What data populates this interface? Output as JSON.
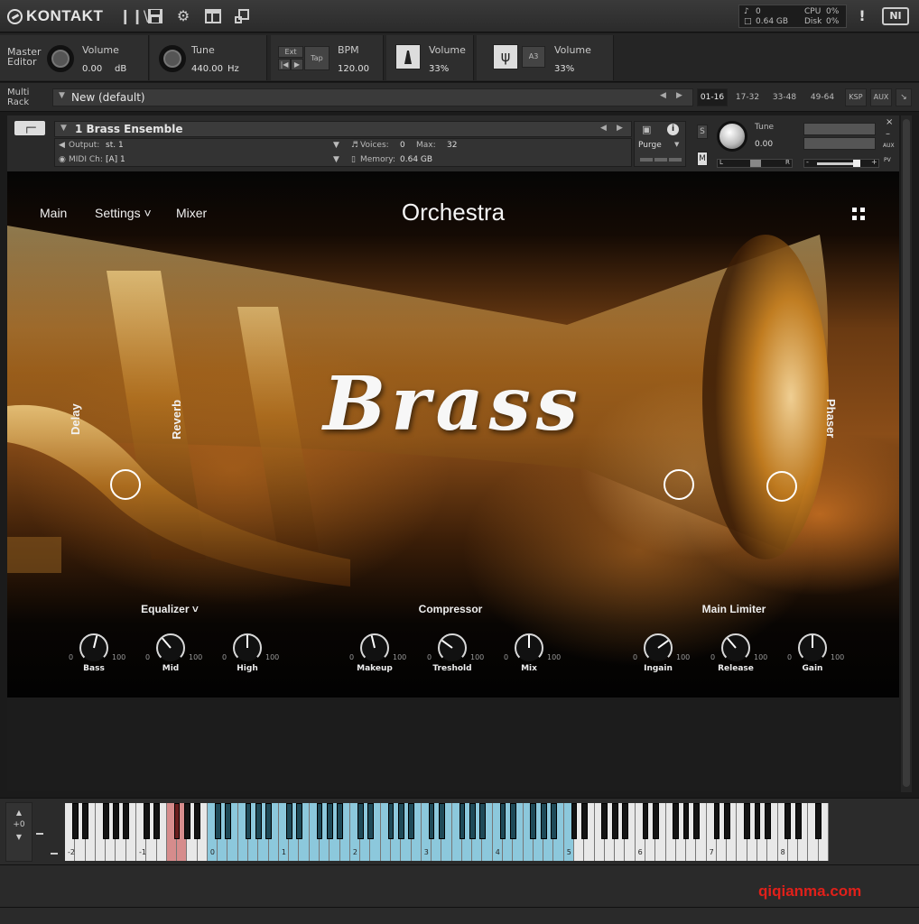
{
  "app": {
    "logo_text": "KONTAKT",
    "status": {
      "midi_label": "♪",
      "midi_value": "0",
      "mem_label": "□",
      "mem_value": "0.64 GB",
      "cpu_label": "CPU",
      "cpu_value": "0%",
      "disk_label": "Disk",
      "disk_value": "0%"
    },
    "warning": "!",
    "ni_badge": "NI"
  },
  "master": {
    "editor_line1": "Master",
    "editor_line2": "Editor",
    "volume_label": "Volume",
    "volume_value": "0.00",
    "volume_unit": "dB",
    "tune_label": "Tune",
    "tune_value": "440.00",
    "tune_unit": "Hz",
    "ext_label": "Ext",
    "tap_label": "Tap",
    "bpm_label": "BPM",
    "bpm_value": "120.00",
    "metro_volume_label": "Volume",
    "metro_volume_value": "33%",
    "ref_volume_label": "Volume",
    "ref_note": "A3",
    "ref_volume_value": "33%"
  },
  "rack": {
    "line1": "Multi",
    "line2": "Rack",
    "name": "New (default)",
    "tabs": [
      "01-16",
      "17-32",
      "33-48",
      "49-64",
      "KSP",
      "AUX"
    ]
  },
  "instrument": {
    "name": "1 Brass Ensemble",
    "output_label": "Output:",
    "output_value": "st. 1",
    "voices_label": "Voices:",
    "voices_value": "0",
    "max_label": "Max:",
    "max_value": "32",
    "midi_label": "MIDI Ch:",
    "midi_value": "[A]  1",
    "memory_label": "Memory:",
    "memory_value": "0.64 GB",
    "purge_label": "Purge",
    "solo": "S",
    "mute": "M",
    "tune_label": "Tune",
    "tune_value": "0.00",
    "pan_left": "L",
    "pan_right": "R",
    "aux": "AUX",
    "pv": "PV",
    "minus": "-",
    "plus": "+"
  },
  "ui": {
    "nav": {
      "main": "Main",
      "settings": "Settings ˅",
      "mixer": "Mixer"
    },
    "title": "Orchestra",
    "logo": "Brass",
    "fx": {
      "delay": "Delay",
      "reverb": "Reverb",
      "phaser": "Phaser"
    },
    "sections": {
      "eq": "Equalizer ˅",
      "comp": "Compressor",
      "limiter": "Main Limiter"
    },
    "knobs": [
      {
        "label": "Bass",
        "min": "0",
        "max": "100",
        "value": 55
      },
      {
        "label": "Mid",
        "min": "0",
        "max": "100",
        "value": 35
      },
      {
        "label": "High",
        "min": "0",
        "max": "100",
        "value": 50
      },
      {
        "label": "Makeup",
        "min": "0",
        "max": "100",
        "value": 45
      },
      {
        "label": "Treshold",
        "min": "0",
        "max": "100",
        "value": 30
      },
      {
        "label": "Mix",
        "min": "0",
        "max": "100",
        "value": 50
      },
      {
        "label": "Ingain",
        "min": "0",
        "max": "100",
        "value": 70
      },
      {
        "label": "Release",
        "min": "0",
        "max": "100",
        "value": 35
      },
      {
        "label": "Gain",
        "min": "0",
        "max": "100",
        "value": 50
      }
    ]
  },
  "keyboard": {
    "octave_shift": "+0",
    "octaves": [
      "-2",
      "-1",
      "0",
      "1",
      "2",
      "3",
      "4",
      "5",
      "6",
      "7",
      "8"
    ],
    "colors": {
      "mapped": "#8cc8dc",
      "keyswitch": "#d68c8c"
    }
  },
  "footer": {
    "credit": "qiqianma.com"
  }
}
